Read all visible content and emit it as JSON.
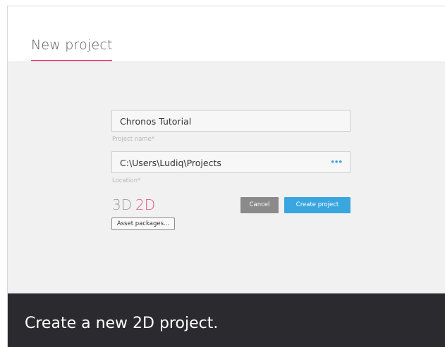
{
  "dialog": {
    "title": "New project",
    "accent_color": "#e8527f"
  },
  "form": {
    "project_name": {
      "value": "Chronos Tutorial",
      "label": "Project name*"
    },
    "location": {
      "value": "C:\\Users\\Ludiq\\Projects",
      "label": "Location*",
      "browse_icon": "ellipsis-icon",
      "browse_glyph": "•••"
    },
    "mode_3d_label": "3D",
    "mode_2d_label": "2D",
    "selected_mode": "2D",
    "asset_packages_label": "Asset packages...",
    "cancel_label": "Cancel",
    "create_label": "Create project",
    "create_color": "#3aa6e0",
    "cancel_color": "#8a8a8a"
  },
  "caption": {
    "text": "Create a new 2D project."
  }
}
